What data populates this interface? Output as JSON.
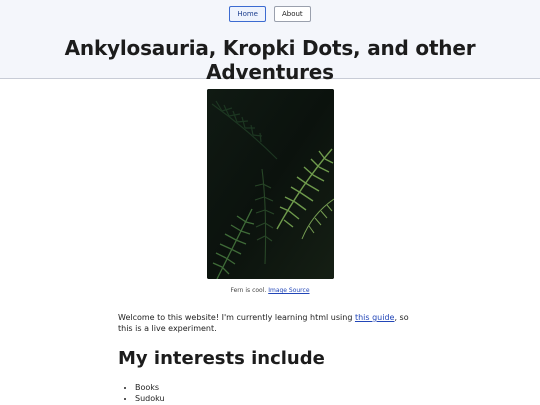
{
  "nav": {
    "home_label": "Home",
    "about_label": "About"
  },
  "header": {
    "title": "Ankylosauria, Kropki Dots, and other Adventures"
  },
  "figure": {
    "image_alt": "Fern",
    "caption_text": "Fern is cool. ",
    "caption_link": "Image Source"
  },
  "main": {
    "intro_before": "Welcome to this website! I'm currently learning html using ",
    "intro_link": "this guide",
    "intro_after": ", so this is a live experiment.",
    "interests_heading": "My interests include",
    "interests": [
      "Books",
      "Sudoku"
    ]
  },
  "colors": {
    "header_bg": "#f4f6fb",
    "link": "#2246b8",
    "active_nav_border": "#3c6bd1"
  }
}
